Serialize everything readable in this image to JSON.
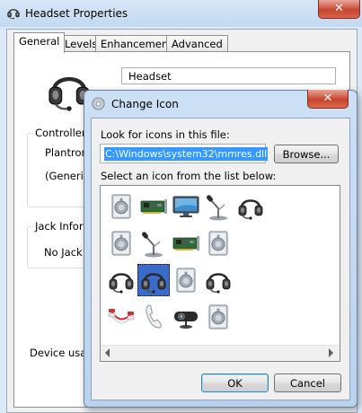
{
  "props_window": {
    "title": "Headset Properties",
    "close_glyph": "✕",
    "tabs": [
      {
        "label": "General",
        "active": true
      },
      {
        "label": "Levels",
        "active": false
      },
      {
        "label": "Enhancements",
        "active": false
      },
      {
        "label": "Advanced",
        "active": false
      }
    ],
    "device_name": "Headset",
    "controller_label": "Controller I",
    "controller_name": "Plantroni",
    "controller_sub": "(Generic",
    "jack_label": "Jack Inform",
    "jack_value": "No Jack In",
    "device_usage_label": "Device usage"
  },
  "change_icon_dialog": {
    "title": "Change Icon",
    "close_glyph": "✕",
    "file_label": "Look for icons in this file:",
    "file_value": "C:\\Windows\\system32\\mmres.dll",
    "browse_label": "Browse...",
    "list_label": "Select an icon from the list below:",
    "icons": [
      {
        "name": "speaker-icon"
      },
      {
        "name": "sound-card-icon"
      },
      {
        "name": "monitor-icon"
      },
      {
        "name": "microphone-icon"
      },
      {
        "name": "headset-icon"
      },
      {
        "name": "speaker-icon"
      },
      {
        "name": "microphone-icon"
      },
      {
        "name": "sound-card-icon"
      },
      {
        "name": "speaker-icon"
      },
      {
        "name": "headset-icon"
      },
      {
        "name": "headset-icon",
        "selected": true
      },
      {
        "name": "speaker-icon"
      },
      {
        "name": "headset-icon"
      },
      {
        "name": "rca-cable-icon"
      },
      {
        "name": "phone-handset-icon"
      },
      {
        "name": "webcam-icon"
      },
      {
        "name": "speaker-icon"
      }
    ],
    "ok_label": "OK",
    "cancel_label": "Cancel"
  },
  "colors": {
    "selection": "#3a6bc9",
    "text_highlight": "#3399ff",
    "close_button": "#c7452f"
  }
}
